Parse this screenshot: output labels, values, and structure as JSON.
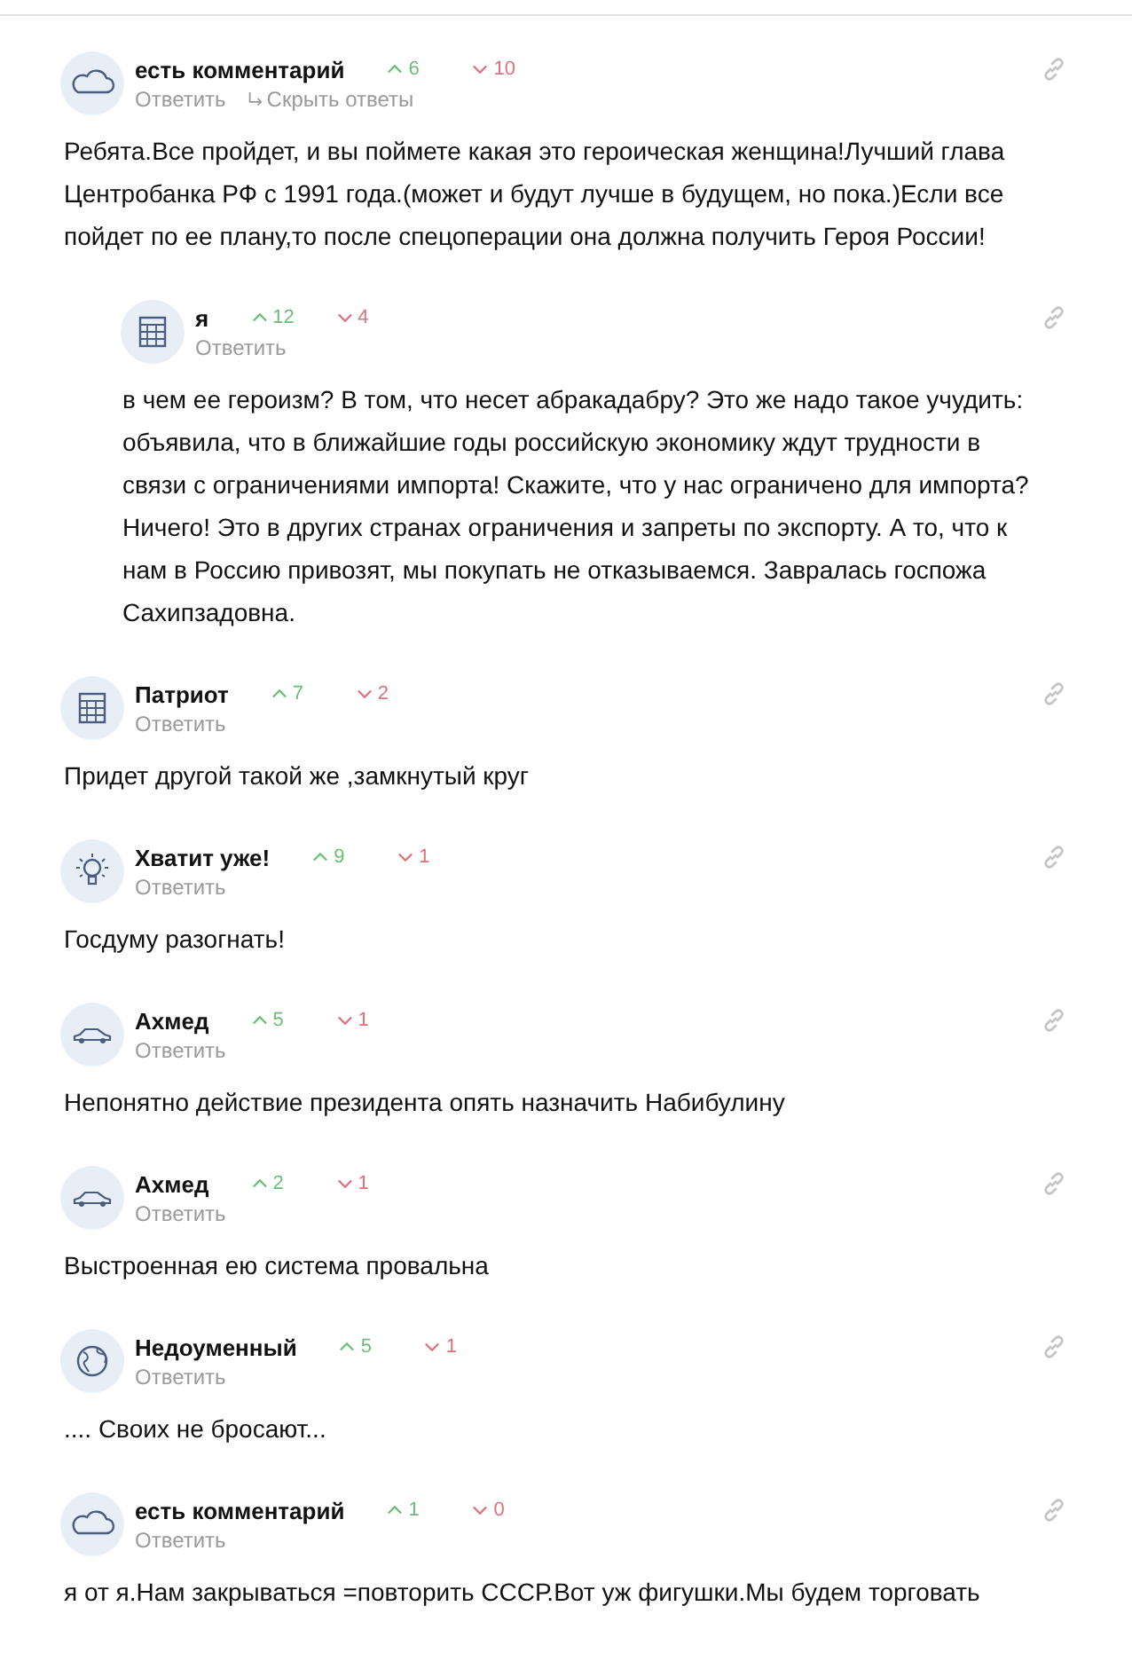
{
  "comments": [
    {
      "author": "есть комментарий",
      "kind": "cloud",
      "up": "6",
      "down": "10",
      "reply": "Ответить",
      "hide_replies": "Скрыть ответы",
      "text": "Ребята.Все пройдет, и вы поймете какая это героическая женщина!Лучший глава Центробанка РФ с 1991 года.(может и будут лучше в будущем, но пока.)Если все пойдет по ее плану,то после спецоперации она должна получить Героя России!",
      "children": [
        {
          "author": "я",
          "kind": "calculator",
          "up": "12",
          "down": "4",
          "reply": "Ответить",
          "text": "в чем ее героизм? В том, что несет абракадабру? Это же надо такое учудить: объявила, что в ближайшие годы российскую экономику ждут трудности в связи с ограничениями импорта! Скажите, что у нас ограничено для импорта? Ничего! Это в других странах ограничения и запреты по экспорту. А то, что к нам в Россию привозят, мы покупать не отказываемся. Завралась госпожа Сахипзадовна."
        }
      ]
    },
    {
      "author": "Патриот",
      "kind": "calculator",
      "up": "7",
      "down": "2",
      "reply": "Ответить",
      "text": "Придет другой такой же ,замкнутый круг"
    },
    {
      "author": "Хватит уже!",
      "kind": "bulb",
      "up": "9",
      "down": "1",
      "reply": "Ответить",
      "text": "Госдуму разогнать!"
    },
    {
      "author": "Ахмед",
      "kind": "car",
      "up": "5",
      "down": "1",
      "reply": "Ответить",
      "text": "Непонятно действие президента опять назначить Набибулину"
    },
    {
      "author": "Ахмед",
      "kind": "car",
      "up": "2",
      "down": "1",
      "reply": "Ответить",
      "text": "Выстроенная ею система провальна"
    },
    {
      "author": "Недоуменный",
      "kind": "globe",
      "up": "5",
      "down": "1",
      "reply": "Ответить",
      "text": ".... Своих не бросают..."
    },
    {
      "author": "есть комментарий",
      "kind": "cloud",
      "up": "1",
      "down": "0",
      "reply": "Ответить",
      "text": "я от я.Нам закрываться =повторить СССР.Вот уж фигушки.Мы будем торговать"
    }
  ]
}
